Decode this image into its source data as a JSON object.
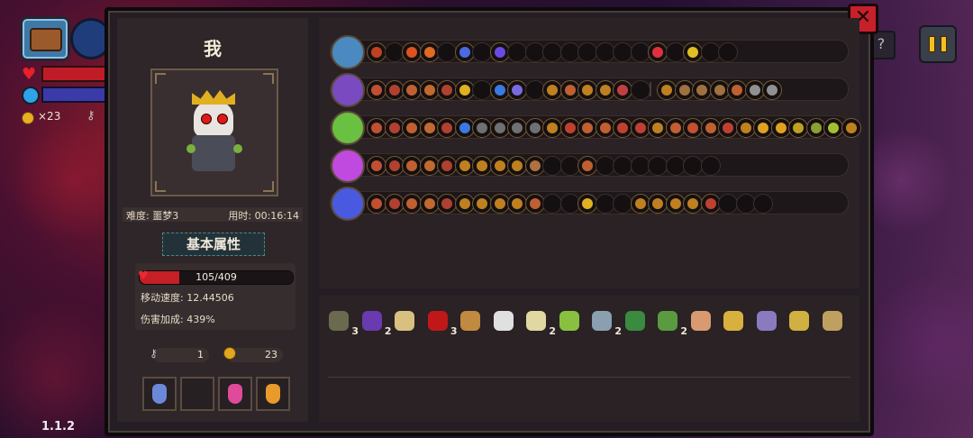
{
  "hud": {
    "coins": "×23",
    "version": "1.1.2"
  },
  "player": {
    "name": "我",
    "difficulty": "难度: 噩梦3",
    "time": "用时: 00:16:14",
    "stats_title": "基本属性",
    "hp": "105/409",
    "hp_fraction": 0.26,
    "move_speed": "移动速度: 12.44506",
    "damage_bonus": "伤害加成: 439%",
    "keys": "1",
    "gold": "23"
  },
  "potions": [
    {
      "name": "blue-potion",
      "color": "#6a8ad8"
    },
    {
      "name": "empty-slot",
      "color": ""
    },
    {
      "name": "pink-potion",
      "color": "#e04a9a"
    },
    {
      "name": "orange-potion",
      "color": "#e89a2a"
    }
  ],
  "weapon_rows": [
    {
      "icon": "chest-icon",
      "icon_color": "#4a8ac0",
      "cells": [
        "#c04020",
        "#000",
        "#e05020",
        "#e06a20",
        "#000",
        "#4a6ae0",
        "#000",
        "#6a4ae0",
        "#000",
        "#000",
        "#000",
        "#000",
        "#000",
        "#000",
        "#000",
        "#000",
        "#e03040",
        "#000",
        "#e0c020",
        "#000",
        "#000"
      ]
    },
    {
      "icon": "staff-icon-purple",
      "icon_color": "#7a4ac0",
      "cells": [
        "#c05030",
        "#b04030",
        "#c06030",
        "#c06a30",
        "#b04030",
        "#e0b020",
        "#000",
        "#3a7ae0",
        "#7a6ae0",
        "#000",
        "#c08020",
        "#c06030",
        "#c08020",
        "#c08020",
        "#c04040",
        "#000",
        "sep",
        "#c08020",
        "#a07040",
        "#a07040",
        "#a07040",
        "#c06030",
        "#909090",
        "#909090"
      ]
    },
    {
      "icon": "staff-icon-green",
      "icon_color": "#6ac040",
      "cells": [
        "#c05030",
        "#b04030",
        "#c06030",
        "#c06a30",
        "#b04030",
        "#3a7ae0",
        "#707070",
        "#707070",
        "#707070",
        "#707070",
        "#c08020",
        "#c04030",
        "#c06030",
        "#c06030",
        "#c04030",
        "#c04030",
        "#c08020",
        "#c06030",
        "#c05030",
        "#c06030",
        "#c04030",
        "#c08020",
        "#e0a020",
        "#e0a020",
        "#c0a020",
        "#8aa030",
        "#a0c030",
        "#c08020"
      ]
    },
    {
      "icon": "wand-icon",
      "icon_color": "#c04ae0",
      "cells": [
        "#c05030",
        "#b04030",
        "#c06030",
        "#c06a30",
        "#b04030",
        "#c08020",
        "#c08020",
        "#c08020",
        "#c08020",
        "#b07040",
        "#000",
        "#000",
        "#c06030",
        "#000",
        "#000",
        "#000",
        "#000",
        "#000",
        "#000",
        "#000"
      ]
    },
    {
      "icon": "vortex-icon",
      "icon_color": "#4a5ae0",
      "cells": [
        "#c05030",
        "#b04030",
        "#c06030",
        "#c06a30",
        "#b04030",
        "#c08020",
        "#c08020",
        "#c08020",
        "#c08020",
        "#c06030",
        "#000",
        "#000",
        "#e0b020",
        "#000",
        "#000",
        "#c08020",
        "#c08020",
        "#c08020",
        "#c08020",
        "#c04030",
        "#000",
        "#000",
        "#000"
      ]
    }
  ],
  "items": [
    {
      "name": "turtle-shell-item",
      "color": "#6a6a50",
      "count": "3"
    },
    {
      "name": "witch-hat-item",
      "color": "#6a3ab0",
      "count": "2"
    },
    {
      "name": "bread-item",
      "color": "#d8c080",
      "count": ""
    },
    {
      "name": "red-eye-item",
      "color": "#c01818",
      "count": "3"
    },
    {
      "name": "scroll-item",
      "color": "#c08a40",
      "count": ""
    },
    {
      "name": "skull-gem-item",
      "color": "#e0e0e0",
      "count": ""
    },
    {
      "name": "fangs-item",
      "color": "#e0d8a0",
      "count": "2"
    },
    {
      "name": "leaf-item",
      "color": "#8ac040",
      "count": ""
    },
    {
      "name": "feather-item",
      "color": "#8aa0b0",
      "count": "2"
    },
    {
      "name": "green-boot-item",
      "color": "#3a8a40",
      "count": ""
    },
    {
      "name": "vine-item",
      "color": "#5a9a40",
      "count": "2"
    },
    {
      "name": "egg-item",
      "color": "#d89a70",
      "count": ""
    },
    {
      "name": "golden-key-item",
      "color": "#d8b040",
      "count": ""
    },
    {
      "name": "rune-tablet-item",
      "color": "#8a7ac0",
      "count": ""
    },
    {
      "name": "antler-item",
      "color": "#d0b040",
      "count": ""
    },
    {
      "name": "claw-glove-item",
      "color": "#c0a060",
      "count": ""
    }
  ]
}
